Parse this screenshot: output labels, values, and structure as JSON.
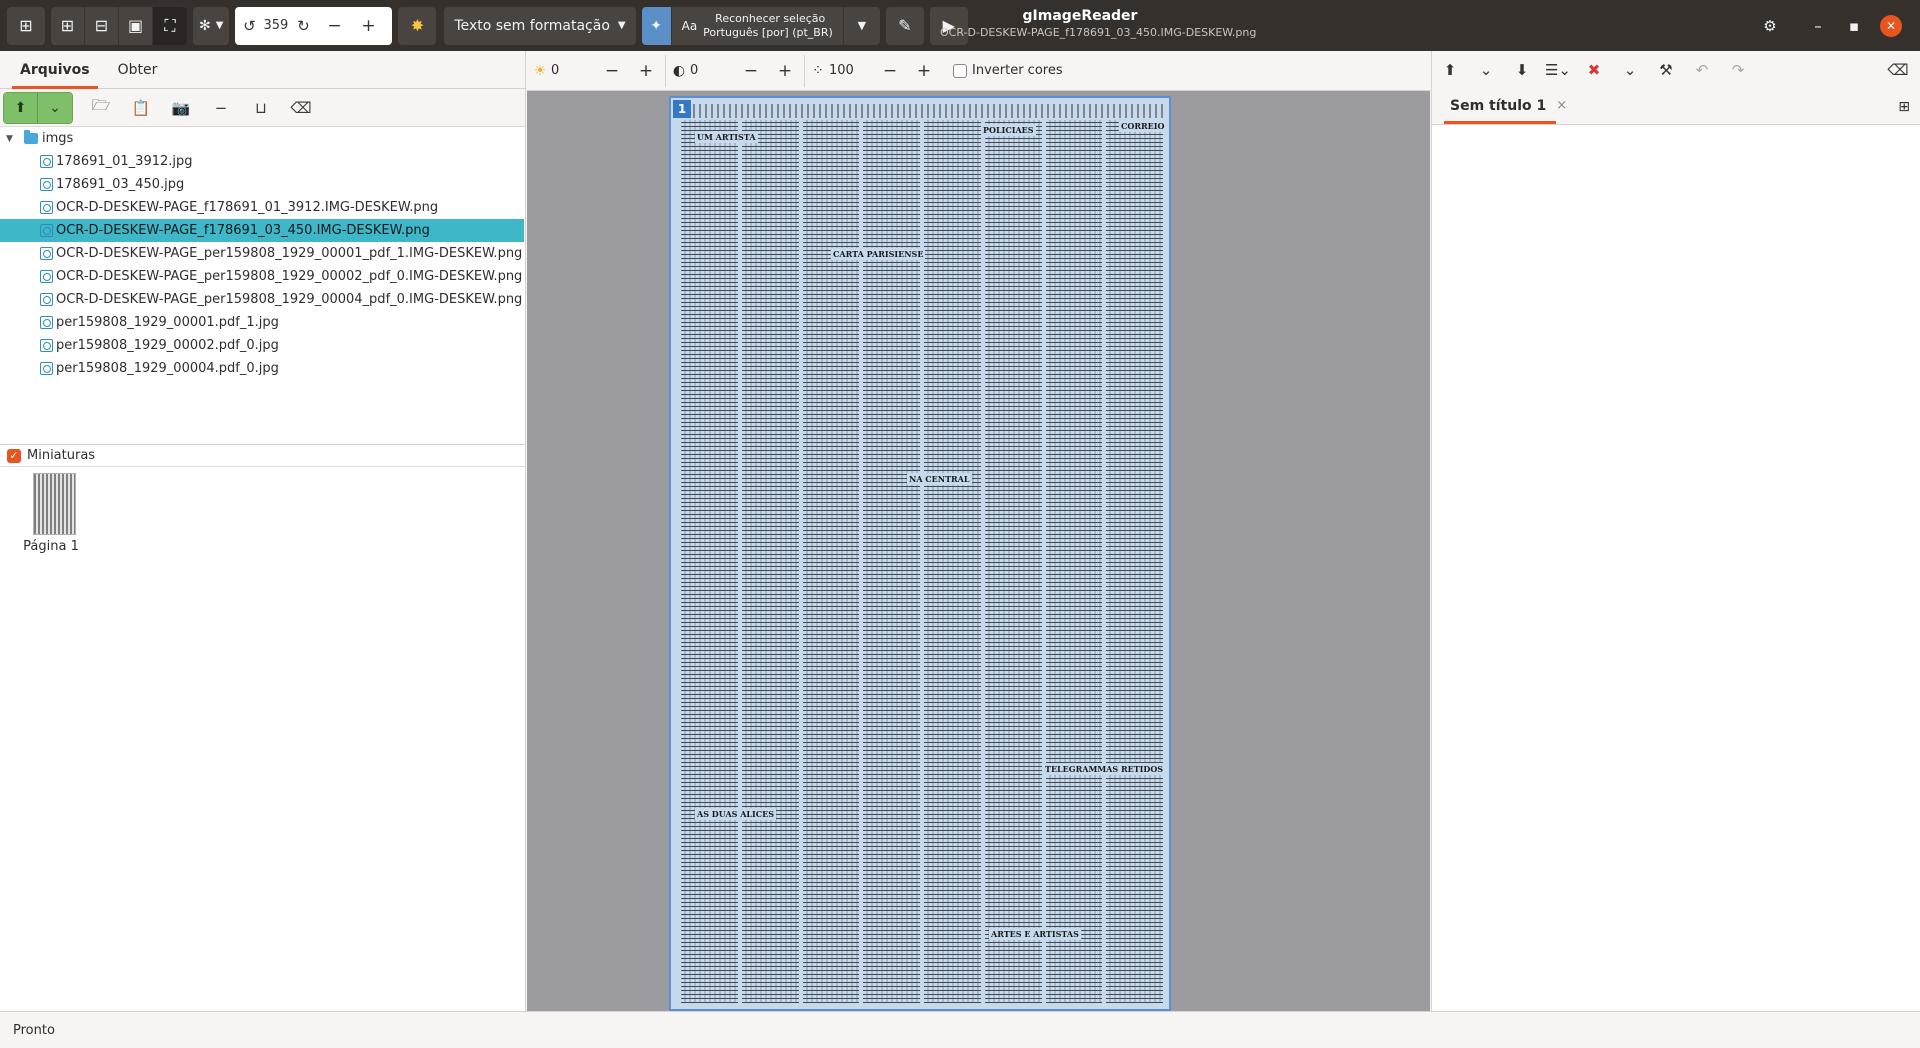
{
  "header": {
    "title": "gImageReader",
    "subtitle": "OCR-D-DESKEW-PAGE_f178691_03_450.IMG-DESKEW.png",
    "rotation_value": "359,",
    "output_mode": "Texto sem formatação",
    "recognize_label": "Reconhecer seleção",
    "recognize_language": "Português [por] (pt_BR)",
    "icons": [
      "add-source-icon",
      "zoom-in-icon",
      "zoom-out-icon",
      "original-size-icon",
      "best-fit-icon",
      "autodetect-layout-icon",
      "rotate-left-icon",
      "rotate-right-icon",
      "scanner-icon",
      "magic-wand-icon",
      "edit-icon",
      "play-icon",
      "settings-icon",
      "minimize-icon",
      "maximize-icon",
      "close-icon"
    ]
  },
  "left": {
    "tabs": [
      "Arquivos",
      "Obter"
    ],
    "active_tab": 0,
    "folder": "imgs",
    "files": [
      "178691_01_3912.jpg",
      "178691_03_450.jpg",
      "OCR-D-DESKEW-PAGE_f178691_01_3912.IMG-DESKEW.png",
      "OCR-D-DESKEW-PAGE_f178691_03_450.IMG-DESKEW.png",
      "OCR-D-DESKEW-PAGE_per159808_1929_00001_pdf_1.IMG-DESKEW.png",
      "OCR-D-DESKEW-PAGE_per159808_1929_00002_pdf_0.IMG-DESKEW.png",
      "OCR-D-DESKEW-PAGE_per159808_1929_00004_pdf_0.IMG-DESKEW.png",
      "per159808_1929_00001.pdf_1.jpg",
      "per159808_1929_00002.pdf_0.jpg",
      "per159808_1929_00004.pdf_0.jpg"
    ],
    "selected_index": 3,
    "thumbnails_label": "Miniaturas",
    "thumbnails_checked": true,
    "thumb_caption": "Página 1"
  },
  "center": {
    "brightness": "0",
    "contrast": "0",
    "resolution": "100",
    "invert_label": "Inverter cores",
    "invert_checked": false,
    "page_number": "1",
    "page_headings": [
      "UM ARTISTA",
      "POLICIAES",
      "CORREIO",
      "CARTA PARISIENSE",
      "NA CENTRAL",
      "AS DUAS ALICES",
      "TELEGRAMMAS RETIDOS",
      "ARTES E ARTISTAS"
    ]
  },
  "right": {
    "tab_title": "Sem título 1",
    "tab_close": "×"
  },
  "status": {
    "text": "Pronto"
  },
  "colors": {
    "accent": "#e95420",
    "selection": "#3eb8c9",
    "headerbar": "#36302c"
  }
}
